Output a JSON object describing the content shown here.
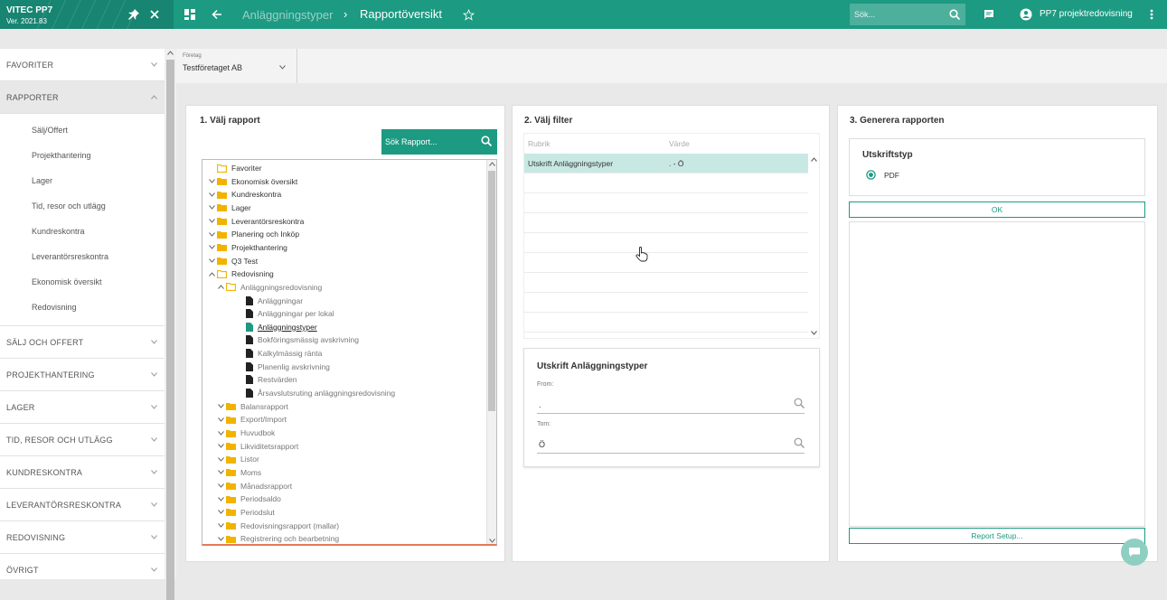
{
  "app": {
    "name": "VITEC PP7",
    "version": "Ver. 2021.83"
  },
  "breadcrumb": {
    "previous": "Anläggningstyper",
    "separator": "›",
    "current": "Rapportöversikt"
  },
  "header_search": {
    "placeholder": "Sök..."
  },
  "user": {
    "name": "PP7 projektredovisning"
  },
  "icons": {
    "pin": "pin-icon",
    "close": "close-icon",
    "grid": "grid-icon",
    "back": "back-arrow-icon",
    "star": "star-icon",
    "search": "search-icon",
    "chat": "chat-icon",
    "account": "account-icon",
    "more": "more-vert-icon"
  },
  "colors": {
    "primary": "#1c9a82",
    "primary_dark": "#178571",
    "folder": "#f2b300",
    "doc": "#222222",
    "doc_selected": "#1c9a82",
    "selected_row": "#c8e8e3",
    "tree_underline": "#e47a5a"
  },
  "company": {
    "label": "Företag",
    "value": "Testföretaget AB"
  },
  "sidebar": {
    "sections": [
      {
        "label": "FAVORITER",
        "open": false,
        "items": []
      },
      {
        "label": "RAPPORTER",
        "open": true,
        "items": [
          "Sälj/Offert",
          "Projekthantering",
          "Lager",
          "Tid, resor och utlägg",
          "Kundreskontra",
          "Leverantörsreskontra",
          "Ekonomisk översikt",
          "Redovisning"
        ]
      },
      {
        "label": "SÄLJ OCH OFFERT",
        "open": false,
        "items": []
      },
      {
        "label": "PROJEKTHANTERING",
        "open": false,
        "items": []
      },
      {
        "label": "LAGER",
        "open": false,
        "items": []
      },
      {
        "label": "TID, RESOR OCH UTLÄGG",
        "open": false,
        "items": []
      },
      {
        "label": "KUNDRESKONTRA",
        "open": false,
        "items": []
      },
      {
        "label": "LEVERANTÖRSRESKONTRA",
        "open": false,
        "items": []
      },
      {
        "label": "REDOVISNING",
        "open": false,
        "items": []
      },
      {
        "label": "ÖVRIGT",
        "open": false,
        "items": []
      }
    ]
  },
  "panel1": {
    "title": "1. Välj rapport",
    "search_placeholder": "Sök Rapport...",
    "tree": [
      {
        "label": "Favoriter",
        "level": 0,
        "type": "folder-open",
        "expander": "none"
      },
      {
        "label": "Ekonomisk översikt",
        "level": 0,
        "type": "folder",
        "expander": "collapsed"
      },
      {
        "label": "Kundreskontra",
        "level": 0,
        "type": "folder",
        "expander": "collapsed"
      },
      {
        "label": "Lager",
        "level": 0,
        "type": "folder",
        "expander": "collapsed"
      },
      {
        "label": "Leverantörsreskontra",
        "level": 0,
        "type": "folder",
        "expander": "collapsed"
      },
      {
        "label": "Planering och Inköp",
        "level": 0,
        "type": "folder",
        "expander": "collapsed"
      },
      {
        "label": "Projekthantering",
        "level": 0,
        "type": "folder",
        "expander": "collapsed"
      },
      {
        "label": "Q3 Test",
        "level": 0,
        "type": "folder",
        "expander": "collapsed"
      },
      {
        "label": "Redovisning",
        "level": 0,
        "type": "folder-open",
        "expander": "expanded"
      },
      {
        "label": "Anläggningsredovisning",
        "level": 1,
        "type": "folder-open",
        "expander": "expanded"
      },
      {
        "label": "Anläggningar",
        "level": 2,
        "type": "doc",
        "expander": "none"
      },
      {
        "label": "Anläggningar per lokal",
        "level": 2,
        "type": "doc",
        "expander": "none"
      },
      {
        "label": "Anläggningstyper",
        "level": 2,
        "type": "doc",
        "expander": "none",
        "selected": true
      },
      {
        "label": "Bokföringsmässig avskrivning",
        "level": 2,
        "type": "doc",
        "expander": "none"
      },
      {
        "label": "Kalkylmässig ränta",
        "level": 2,
        "type": "doc",
        "expander": "none"
      },
      {
        "label": "Planenlig avskrivning",
        "level": 2,
        "type": "doc",
        "expander": "none"
      },
      {
        "label": "Restvärden",
        "level": 2,
        "type": "doc",
        "expander": "none"
      },
      {
        "label": "Årsavslutsruting anläggningsredovisning",
        "level": 2,
        "type": "doc",
        "expander": "none"
      },
      {
        "label": "Balansrapport",
        "level": 1,
        "type": "folder",
        "expander": "collapsed"
      },
      {
        "label": "Export/Import",
        "level": 1,
        "type": "folder",
        "expander": "collapsed"
      },
      {
        "label": "Huvudbok",
        "level": 1,
        "type": "folder",
        "expander": "collapsed"
      },
      {
        "label": "Likviditetsrapport",
        "level": 1,
        "type": "folder",
        "expander": "collapsed"
      },
      {
        "label": "Listor",
        "level": 1,
        "type": "folder",
        "expander": "collapsed"
      },
      {
        "label": "Moms",
        "level": 1,
        "type": "folder",
        "expander": "collapsed"
      },
      {
        "label": "Månadsrapport",
        "level": 1,
        "type": "folder",
        "expander": "collapsed"
      },
      {
        "label": "Periodsaldo",
        "level": 1,
        "type": "folder",
        "expander": "collapsed"
      },
      {
        "label": "Periodslut",
        "level": 1,
        "type": "folder",
        "expander": "collapsed"
      },
      {
        "label": "Redovisningsrapport (mallar)",
        "level": 1,
        "type": "folder",
        "expander": "collapsed"
      },
      {
        "label": "Registrering och bearbetning",
        "level": 1,
        "type": "folder",
        "expander": "collapsed"
      }
    ]
  },
  "panel2": {
    "title": "2. Välj filter",
    "table": {
      "headers": [
        "Rubrik",
        "Värde"
      ],
      "rows": [
        {
          "rubrik": "Utskrift Anläggningstyper",
          "varde": ". - Ö"
        }
      ]
    },
    "detail": {
      "title": "Utskrift Anläggningstyper",
      "from_label": "From:",
      "from_value": ".",
      "tom_label": "Tom:",
      "tom_value": "Ö"
    }
  },
  "panel3": {
    "title": "3. Generera rapporten",
    "output_title": "Utskriftstyp",
    "output_option": "PDF",
    "ok_label": "OK",
    "setup_label": "Report Setup..."
  }
}
